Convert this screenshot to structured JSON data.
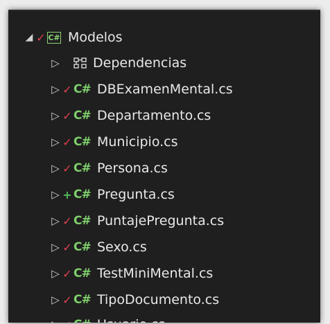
{
  "tree": {
    "root": {
      "expander": "◢",
      "status": "✓",
      "icon": "C#",
      "label": "Modelos"
    },
    "dependencies": {
      "expander": "▷",
      "label": "Dependencias"
    },
    "files": [
      {
        "expander": "▷",
        "status": "✓",
        "status_type": "check",
        "icon": "C#",
        "label": "DBExamenMental.cs"
      },
      {
        "expander": "▷",
        "status": "✓",
        "status_type": "check",
        "icon": "C#",
        "label": "Departamento.cs"
      },
      {
        "expander": "▷",
        "status": "✓",
        "status_type": "check",
        "icon": "C#",
        "label": "Municipio.cs"
      },
      {
        "expander": "▷",
        "status": "✓",
        "status_type": "check",
        "icon": "C#",
        "label": "Persona.cs"
      },
      {
        "expander": "▷",
        "status": "+",
        "status_type": "add",
        "icon": "C#",
        "label": "Pregunta.cs"
      },
      {
        "expander": "▷",
        "status": "✓",
        "status_type": "check",
        "icon": "C#",
        "label": "PuntajePregunta.cs"
      },
      {
        "expander": "▷",
        "status": "✓",
        "status_type": "check",
        "icon": "C#",
        "label": "Sexo.cs"
      },
      {
        "expander": "▷",
        "status": "✓",
        "status_type": "check",
        "icon": "C#",
        "label": "TestMiniMental.cs"
      },
      {
        "expander": "▷",
        "status": "✓",
        "status_type": "check",
        "icon": "C#",
        "label": "TipoDocumento.cs"
      },
      {
        "expander": "▷",
        "status": "✓",
        "status_type": "check",
        "icon": "C#",
        "label": "Usuario.cs"
      }
    ]
  },
  "colors": {
    "background": "#1f1f1f",
    "checked": "#e0424f",
    "added": "#4fbf5a",
    "csharp": "#7fd06c",
    "text": "#e8e8e8"
  }
}
